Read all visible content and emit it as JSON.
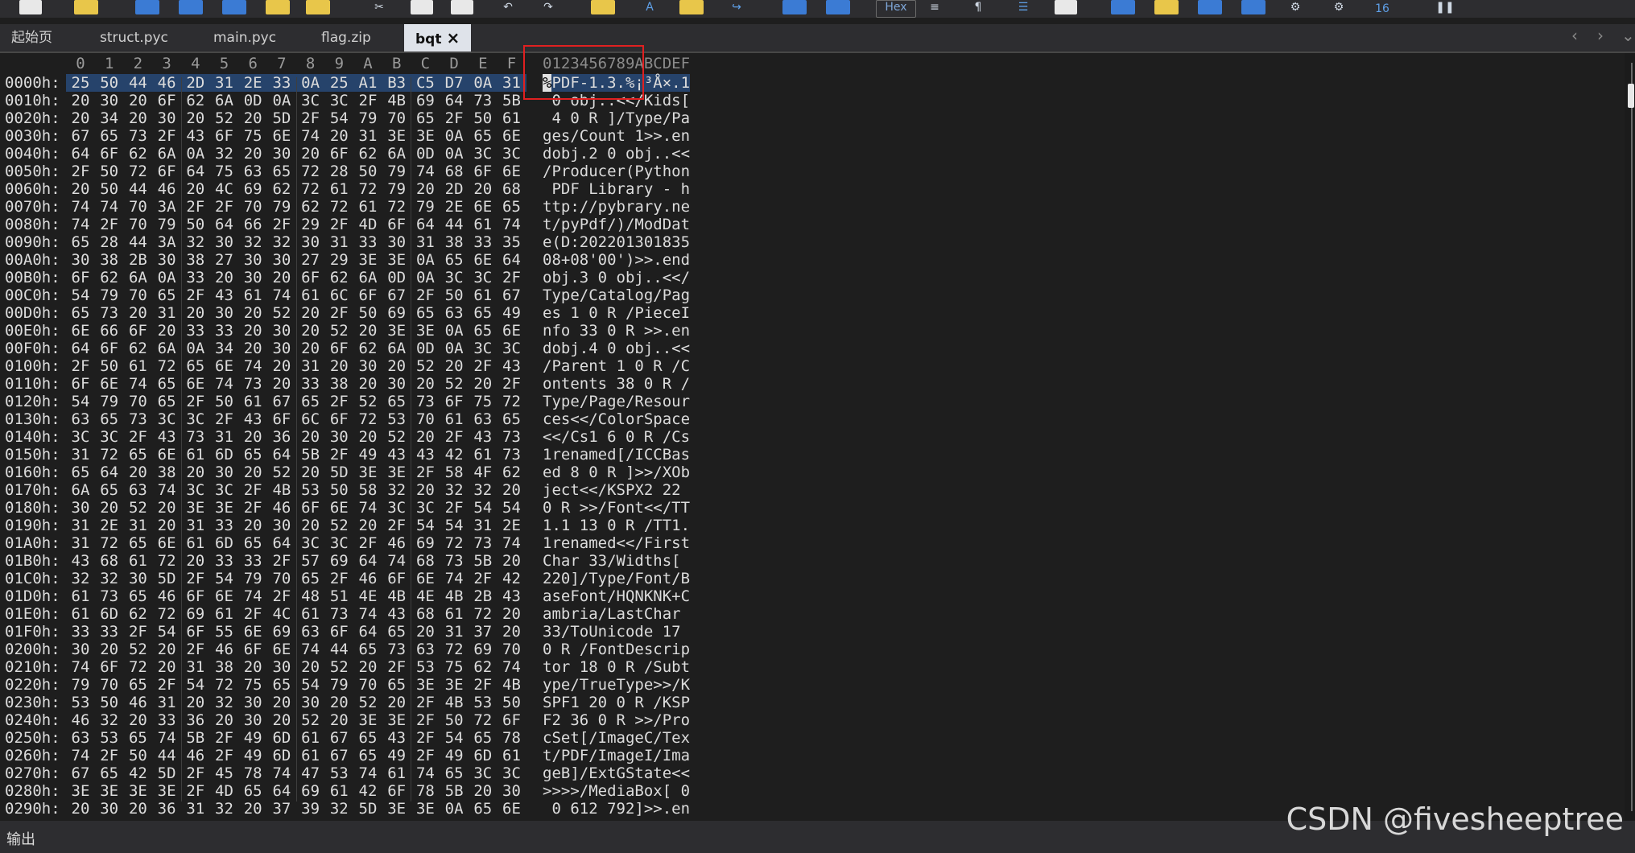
{
  "toolbar": {
    "hex_label": "Hex",
    "badge": "16"
  },
  "tabs": [
    {
      "label": "起始页"
    },
    {
      "label": "struct.pyc"
    },
    {
      "label": "main.pyc"
    },
    {
      "label": "flag.zip"
    },
    {
      "label": "bqt",
      "active": true
    }
  ],
  "editor": {
    "header_cols": [
      "0",
      "1",
      "2",
      "3",
      "4",
      "5",
      "6",
      "7",
      "8",
      "9",
      "A",
      "B",
      "C",
      "D",
      "E",
      "F"
    ],
    "header_ascii": "0123456789ABCDEF",
    "rows": [
      {
        "offset": "0000h:",
        "bytes": [
          "25",
          "50",
          "44",
          "46",
          "2D",
          "31",
          "2E",
          "33",
          "0A",
          "25",
          "A1",
          "B3",
          "C5",
          "D7",
          "0A",
          "31"
        ],
        "ascii": "%PDF-1.3.%¡³Å×.1"
      },
      {
        "offset": "0010h:",
        "bytes": [
          "20",
          "30",
          "20",
          "6F",
          "62",
          "6A",
          "0D",
          "0A",
          "3C",
          "3C",
          "2F",
          "4B",
          "69",
          "64",
          "73",
          "5B"
        ],
        "ascii": " 0 obj..<</Kids["
      },
      {
        "offset": "0020h:",
        "bytes": [
          "20",
          "34",
          "20",
          "30",
          "20",
          "52",
          "20",
          "5D",
          "2F",
          "54",
          "79",
          "70",
          "65",
          "2F",
          "50",
          "61"
        ],
        "ascii": " 4 0 R ]/Type/Pa"
      },
      {
        "offset": "0030h:",
        "bytes": [
          "67",
          "65",
          "73",
          "2F",
          "43",
          "6F",
          "75",
          "6E",
          "74",
          "20",
          "31",
          "3E",
          "3E",
          "0A",
          "65",
          "6E"
        ],
        "ascii": "ges/Count 1>>.en"
      },
      {
        "offset": "0040h:",
        "bytes": [
          "64",
          "6F",
          "62",
          "6A",
          "0A",
          "32",
          "20",
          "30",
          "20",
          "6F",
          "62",
          "6A",
          "0D",
          "0A",
          "3C",
          "3C"
        ],
        "ascii": "dobj.2 0 obj..<<"
      },
      {
        "offset": "0050h:",
        "bytes": [
          "2F",
          "50",
          "72",
          "6F",
          "64",
          "75",
          "63",
          "65",
          "72",
          "28",
          "50",
          "79",
          "74",
          "68",
          "6F",
          "6E"
        ],
        "ascii": "/Producer(Python"
      },
      {
        "offset": "0060h:",
        "bytes": [
          "20",
          "50",
          "44",
          "46",
          "20",
          "4C",
          "69",
          "62",
          "72",
          "61",
          "72",
          "79",
          "20",
          "2D",
          "20",
          "68"
        ],
        "ascii": " PDF Library - h"
      },
      {
        "offset": "0070h:",
        "bytes": [
          "74",
          "74",
          "70",
          "3A",
          "2F",
          "2F",
          "70",
          "79",
          "62",
          "72",
          "61",
          "72",
          "79",
          "2E",
          "6E",
          "65"
        ],
        "ascii": "ttp://pybrary.ne"
      },
      {
        "offset": "0080h:",
        "bytes": [
          "74",
          "2F",
          "70",
          "79",
          "50",
          "64",
          "66",
          "2F",
          "29",
          "2F",
          "4D",
          "6F",
          "64",
          "44",
          "61",
          "74"
        ],
        "ascii": "t/pyPdf/)/ModDat"
      },
      {
        "offset": "0090h:",
        "bytes": [
          "65",
          "28",
          "44",
          "3A",
          "32",
          "30",
          "32",
          "32",
          "30",
          "31",
          "33",
          "30",
          "31",
          "38",
          "33",
          "35"
        ],
        "ascii": "e(D:202201301835"
      },
      {
        "offset": "00A0h:",
        "bytes": [
          "30",
          "38",
          "2B",
          "30",
          "38",
          "27",
          "30",
          "30",
          "27",
          "29",
          "3E",
          "3E",
          "0A",
          "65",
          "6E",
          "64"
        ],
        "ascii": "08+08'00')>>.end"
      },
      {
        "offset": "00B0h:",
        "bytes": [
          "6F",
          "62",
          "6A",
          "0A",
          "33",
          "20",
          "30",
          "20",
          "6F",
          "62",
          "6A",
          "0D",
          "0A",
          "3C",
          "3C",
          "2F"
        ],
        "ascii": "obj.3 0 obj..<</"
      },
      {
        "offset": "00C0h:",
        "bytes": [
          "54",
          "79",
          "70",
          "65",
          "2F",
          "43",
          "61",
          "74",
          "61",
          "6C",
          "6F",
          "67",
          "2F",
          "50",
          "61",
          "67"
        ],
        "ascii": "Type/Catalog/Pag"
      },
      {
        "offset": "00D0h:",
        "bytes": [
          "65",
          "73",
          "20",
          "31",
          "20",
          "30",
          "20",
          "52",
          "20",
          "2F",
          "50",
          "69",
          "65",
          "63",
          "65",
          "49"
        ],
        "ascii": "es 1 0 R /PieceI"
      },
      {
        "offset": "00E0h:",
        "bytes": [
          "6E",
          "66",
          "6F",
          "20",
          "33",
          "33",
          "20",
          "30",
          "20",
          "52",
          "20",
          "3E",
          "3E",
          "0A",
          "65",
          "6E"
        ],
        "ascii": "nfo 33 0 R >>.en"
      },
      {
        "offset": "00F0h:",
        "bytes": [
          "64",
          "6F",
          "62",
          "6A",
          "0A",
          "34",
          "20",
          "30",
          "20",
          "6F",
          "62",
          "6A",
          "0D",
          "0A",
          "3C",
          "3C"
        ],
        "ascii": "dobj.4 0 obj..<<"
      },
      {
        "offset": "0100h:",
        "bytes": [
          "2F",
          "50",
          "61",
          "72",
          "65",
          "6E",
          "74",
          "20",
          "31",
          "20",
          "30",
          "20",
          "52",
          "20",
          "2F",
          "43"
        ],
        "ascii": "/Parent 1 0 R /C"
      },
      {
        "offset": "0110h:",
        "bytes": [
          "6F",
          "6E",
          "74",
          "65",
          "6E",
          "74",
          "73",
          "20",
          "33",
          "38",
          "20",
          "30",
          "20",
          "52",
          "20",
          "2F"
        ],
        "ascii": "ontents 38 0 R /"
      },
      {
        "offset": "0120h:",
        "bytes": [
          "54",
          "79",
          "70",
          "65",
          "2F",
          "50",
          "61",
          "67",
          "65",
          "2F",
          "52",
          "65",
          "73",
          "6F",
          "75",
          "72"
        ],
        "ascii": "Type/Page/Resour"
      },
      {
        "offset": "0130h:",
        "bytes": [
          "63",
          "65",
          "73",
          "3C",
          "3C",
          "2F",
          "43",
          "6F",
          "6C",
          "6F",
          "72",
          "53",
          "70",
          "61",
          "63",
          "65"
        ],
        "ascii": "ces<</ColorSpace"
      },
      {
        "offset": "0140h:",
        "bytes": [
          "3C",
          "3C",
          "2F",
          "43",
          "73",
          "31",
          "20",
          "36",
          "20",
          "30",
          "20",
          "52",
          "20",
          "2F",
          "43",
          "73"
        ],
        "ascii": "<</Cs1 6 0 R /Cs"
      },
      {
        "offset": "0150h:",
        "bytes": [
          "31",
          "72",
          "65",
          "6E",
          "61",
          "6D",
          "65",
          "64",
          "5B",
          "2F",
          "49",
          "43",
          "43",
          "42",
          "61",
          "73"
        ],
        "ascii": "1renamed[/ICCBas"
      },
      {
        "offset": "0160h:",
        "bytes": [
          "65",
          "64",
          "20",
          "38",
          "20",
          "30",
          "20",
          "52",
          "20",
          "5D",
          "3E",
          "3E",
          "2F",
          "58",
          "4F",
          "62"
        ],
        "ascii": "ed 8 0 R ]>>/XOb"
      },
      {
        "offset": "0170h:",
        "bytes": [
          "6A",
          "65",
          "63",
          "74",
          "3C",
          "3C",
          "2F",
          "4B",
          "53",
          "50",
          "58",
          "32",
          "20",
          "32",
          "32",
          "20"
        ],
        "ascii": "ject<</KSPX2 22 "
      },
      {
        "offset": "0180h:",
        "bytes": [
          "30",
          "20",
          "52",
          "20",
          "3E",
          "3E",
          "2F",
          "46",
          "6F",
          "6E",
          "74",
          "3C",
          "3C",
          "2F",
          "54",
          "54"
        ],
        "ascii": "0 R >>/Font<</TT"
      },
      {
        "offset": "0190h:",
        "bytes": [
          "31",
          "2E",
          "31",
          "20",
          "31",
          "33",
          "20",
          "30",
          "20",
          "52",
          "20",
          "2F",
          "54",
          "54",
          "31",
          "2E"
        ],
        "ascii": "1.1 13 0 R /TT1."
      },
      {
        "offset": "01A0h:",
        "bytes": [
          "31",
          "72",
          "65",
          "6E",
          "61",
          "6D",
          "65",
          "64",
          "3C",
          "3C",
          "2F",
          "46",
          "69",
          "72",
          "73",
          "74"
        ],
        "ascii": "1renamed<</First"
      },
      {
        "offset": "01B0h:",
        "bytes": [
          "43",
          "68",
          "61",
          "72",
          "20",
          "33",
          "33",
          "2F",
          "57",
          "69",
          "64",
          "74",
          "68",
          "73",
          "5B",
          "20"
        ],
        "ascii": "Char 33/Widths[ "
      },
      {
        "offset": "01C0h:",
        "bytes": [
          "32",
          "32",
          "30",
          "5D",
          "2F",
          "54",
          "79",
          "70",
          "65",
          "2F",
          "46",
          "6F",
          "6E",
          "74",
          "2F",
          "42"
        ],
        "ascii": "220]/Type/Font/B"
      },
      {
        "offset": "01D0h:",
        "bytes": [
          "61",
          "73",
          "65",
          "46",
          "6F",
          "6E",
          "74",
          "2F",
          "48",
          "51",
          "4E",
          "4B",
          "4E",
          "4B",
          "2B",
          "43"
        ],
        "ascii": "aseFont/HQNKNK+C"
      },
      {
        "offset": "01E0h:",
        "bytes": [
          "61",
          "6D",
          "62",
          "72",
          "69",
          "61",
          "2F",
          "4C",
          "61",
          "73",
          "74",
          "43",
          "68",
          "61",
          "72",
          "20"
        ],
        "ascii": "ambria/LastChar "
      },
      {
        "offset": "01F0h:",
        "bytes": [
          "33",
          "33",
          "2F",
          "54",
          "6F",
          "55",
          "6E",
          "69",
          "63",
          "6F",
          "64",
          "65",
          "20",
          "31",
          "37",
          "20"
        ],
        "ascii": "33/ToUnicode 17 "
      },
      {
        "offset": "0200h:",
        "bytes": [
          "30",
          "20",
          "52",
          "20",
          "2F",
          "46",
          "6F",
          "6E",
          "74",
          "44",
          "65",
          "73",
          "63",
          "72",
          "69",
          "70"
        ],
        "ascii": "0 R /FontDescrip"
      },
      {
        "offset": "0210h:",
        "bytes": [
          "74",
          "6F",
          "72",
          "20",
          "31",
          "38",
          "20",
          "30",
          "20",
          "52",
          "20",
          "2F",
          "53",
          "75",
          "62",
          "74"
        ],
        "ascii": "tor 18 0 R /Subt"
      },
      {
        "offset": "0220h:",
        "bytes": [
          "79",
          "70",
          "65",
          "2F",
          "54",
          "72",
          "75",
          "65",
          "54",
          "79",
          "70",
          "65",
          "3E",
          "3E",
          "2F",
          "4B"
        ],
        "ascii": "ype/TrueType>>/K"
      },
      {
        "offset": "0230h:",
        "bytes": [
          "53",
          "50",
          "46",
          "31",
          "20",
          "32",
          "30",
          "20",
          "30",
          "20",
          "52",
          "20",
          "2F",
          "4B",
          "53",
          "50"
        ],
        "ascii": "SPF1 20 0 R /KSP"
      },
      {
        "offset": "0240h:",
        "bytes": [
          "46",
          "32",
          "20",
          "33",
          "36",
          "20",
          "30",
          "20",
          "52",
          "20",
          "3E",
          "3E",
          "2F",
          "50",
          "72",
          "6F"
        ],
        "ascii": "F2 36 0 R >>/Pro"
      },
      {
        "offset": "0250h:",
        "bytes": [
          "63",
          "53",
          "65",
          "74",
          "5B",
          "2F",
          "49",
          "6D",
          "61",
          "67",
          "65",
          "43",
          "2F",
          "54",
          "65",
          "78"
        ],
        "ascii": "cSet[/ImageC/Tex"
      },
      {
        "offset": "0260h:",
        "bytes": [
          "74",
          "2F",
          "50",
          "44",
          "46",
          "2F",
          "49",
          "6D",
          "61",
          "67",
          "65",
          "49",
          "2F",
          "49",
          "6D",
          "61"
        ],
        "ascii": "t/PDF/ImageI/Ima"
      },
      {
        "offset": "0270h:",
        "bytes": [
          "67",
          "65",
          "42",
          "5D",
          "2F",
          "45",
          "78",
          "74",
          "47",
          "53",
          "74",
          "61",
          "74",
          "65",
          "3C",
          "3C"
        ],
        "ascii": "geB]/ExtGState<<"
      },
      {
        "offset": "0280h:",
        "bytes": [
          "3E",
          "3E",
          "3E",
          "3E",
          "2F",
          "4D",
          "65",
          "64",
          "69",
          "61",
          "42",
          "6F",
          "78",
          "5B",
          "20",
          "30"
        ],
        "ascii": ">>>>/MediaBox[ 0"
      },
      {
        "offset": "0290h:",
        "bytes": [
          "20",
          "30",
          "20",
          "36",
          "31",
          "32",
          "20",
          "37",
          "39",
          "32",
          "5D",
          "3E",
          "3E",
          "0A",
          "65",
          "6E"
        ],
        "ascii": " 0 612 792]>>.en"
      }
    ]
  },
  "output_panel": {
    "label": "输出"
  },
  "watermark": "CSDN @fivesheeptree"
}
